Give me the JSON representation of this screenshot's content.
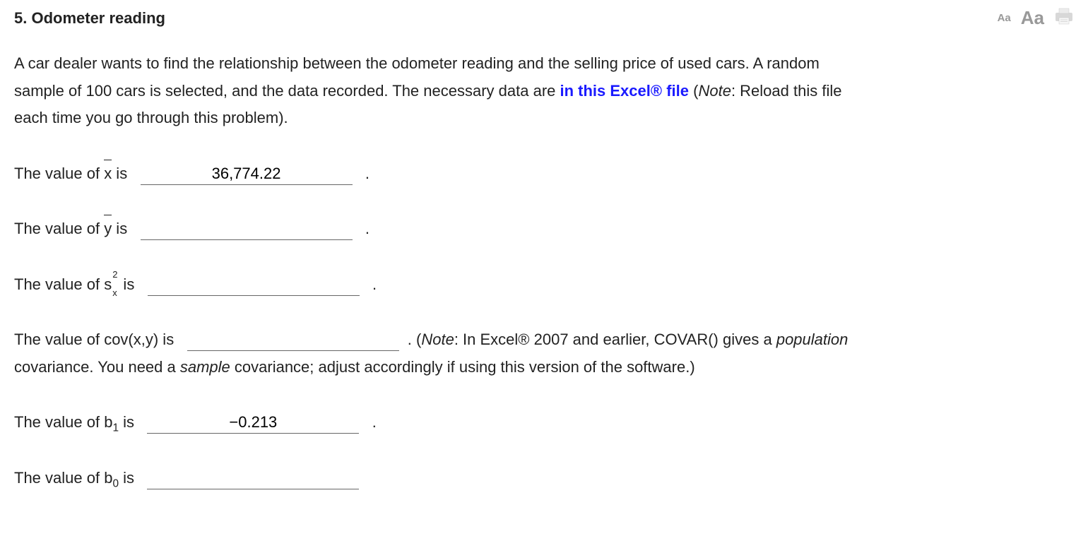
{
  "title": "5.  Odometer reading",
  "tools": {
    "font_small": "Aa",
    "font_large": "Aa"
  },
  "intro": {
    "pre_link": "A car dealer wants to find the relationship between the odometer reading and the selling price of used cars. A random sample of 100 cars is selected, and the data recorded. The necessary data are ",
    "link_text": "in this Excel® file",
    "post_link_1": " (",
    "note_word": "Note",
    "post_link_2": ": Reload this file each time you go through this problem)."
  },
  "q_xbar": {
    "prefix": "The value of ",
    "symbol": "x",
    "suffix": " is",
    "value": "36,774.22",
    "period": "."
  },
  "q_ybar": {
    "prefix": "The value of ",
    "symbol": "y",
    "suffix": " is",
    "value": "",
    "period": "."
  },
  "q_sx2": {
    "prefix": "The value of ",
    "suffix": " is",
    "value": "",
    "period": "."
  },
  "q_cov": {
    "prefix": "The value of cov(x,y) is",
    "value": "",
    "period": ". ",
    "note_open": "(",
    "note_word": "Note",
    "note_body_1": ": In Excel® 2007 and earlier, COVAR() gives a ",
    "note_italic_1": "population",
    "note_body_2": " covariance. You need a ",
    "note_italic_2": "sample",
    "note_body_3": " covariance; adjust accordingly if using this version of the software.)"
  },
  "q_b1": {
    "prefix": "The value of b",
    "sub": "1",
    "suffix": " is",
    "value": "−0.213",
    "period": "."
  },
  "q_b0": {
    "prefix": "The value of b",
    "sub": "0",
    "suffix": " is",
    "value": "",
    "period": ""
  }
}
